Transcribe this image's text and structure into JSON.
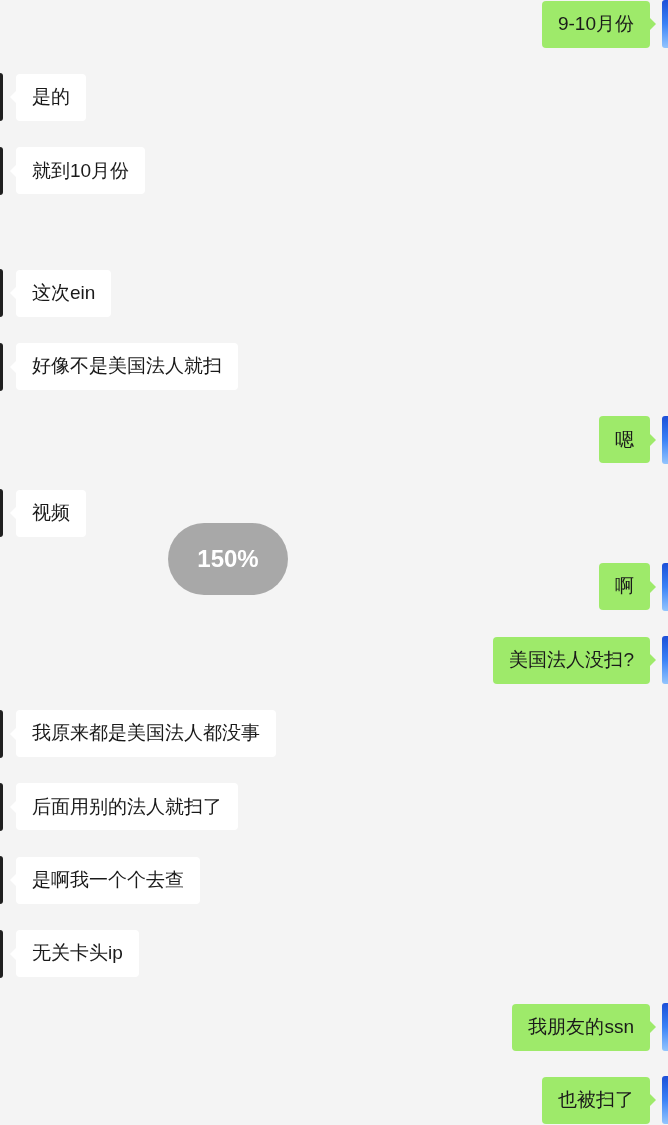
{
  "messages": [
    {
      "kind": "sent",
      "text": "9-10月份"
    },
    {
      "kind": "received",
      "text": "是的"
    },
    {
      "kind": "received",
      "text": "就到10月份"
    },
    {
      "kind": "received",
      "text": "这次ein"
    },
    {
      "kind": "received",
      "text": "好像不是美国法人就扫"
    },
    {
      "kind": "sent",
      "text": "嗯"
    },
    {
      "kind": "received",
      "text": "视频"
    },
    {
      "kind": "sent",
      "text": "啊"
    },
    {
      "kind": "sent",
      "text": "美国法人没扫?"
    },
    {
      "kind": "received",
      "text": "我原来都是美国法人都没事"
    },
    {
      "kind": "received",
      "text": "后面用别的法人就扫了"
    },
    {
      "kind": "received",
      "text": "是啊我一个个去查"
    },
    {
      "kind": "received",
      "text": "无关卡头ip"
    },
    {
      "kind": "sent",
      "text": "我朋友的ssn"
    },
    {
      "kind": "sent",
      "text": "也被扫了"
    }
  ],
  "zoom_indicator": "150%"
}
